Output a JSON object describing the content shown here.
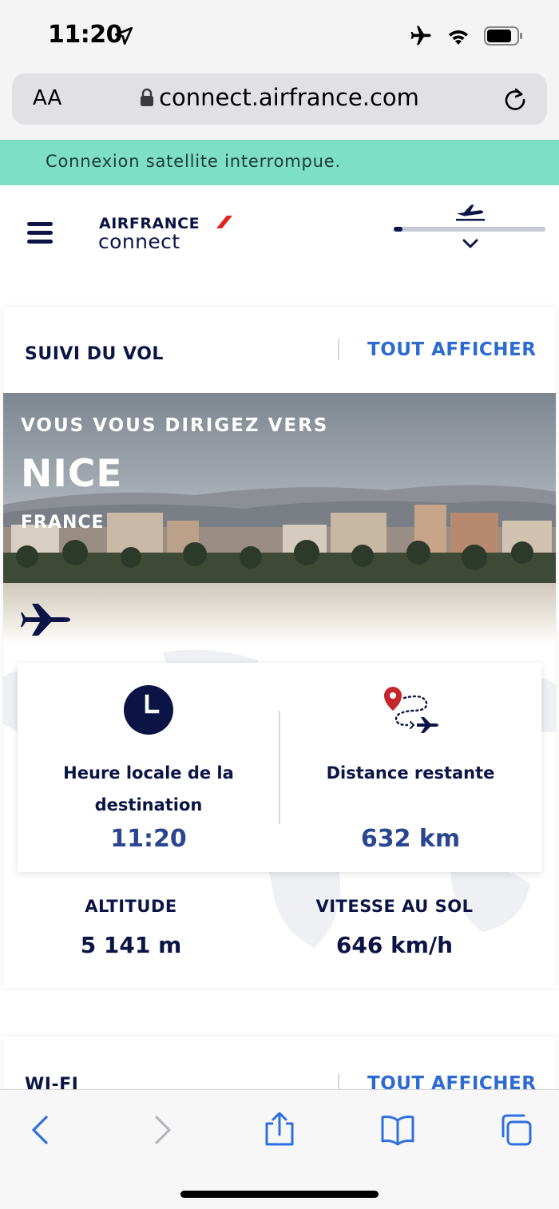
{
  "status_bar": {
    "time": "11:20"
  },
  "browser": {
    "text_size_label": "AA",
    "url": "connect.airfrance.com"
  },
  "banner": {
    "message": "Connexion satellite interrompue."
  },
  "header": {
    "brand": "AIRFRANCE",
    "sub_brand": "connect",
    "flight_progress": 0.06
  },
  "flight_card": {
    "title": "SUIVI DU VOL",
    "link": "TOUT AFFICHER",
    "hero": {
      "subtitle": "VOUS VOUS DIRIGEZ VERS",
      "city": "NICE",
      "country": "FRANCE"
    },
    "local_time": {
      "label": "Heure locale de la destination",
      "value": "11:20"
    },
    "distance": {
      "label": "Distance restante",
      "value": "632 km"
    },
    "altitude": {
      "label": "ALTITUDE",
      "value": "5 141 m"
    },
    "ground_speed": {
      "label": "VITESSE AU SOL",
      "value": "646 km/h"
    }
  },
  "wifi_card": {
    "title": "WI-FI",
    "link": "TOUT AFFICHER"
  },
  "colors": {
    "accent": "#2d6bd1",
    "navy": "#0b1445",
    "banner": "#7ddfc3",
    "brand_red": "#e1221f"
  }
}
